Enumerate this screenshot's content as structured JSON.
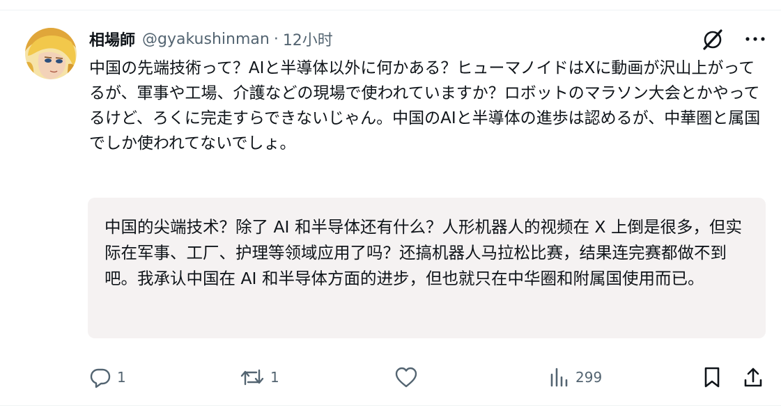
{
  "post": {
    "display_name": "相場師",
    "handle": "@gyakushinman",
    "separator": "·",
    "time": "12小时",
    "text": "中国の先端技術って？AIと半導体以外に何かある？ヒューマノイドはXに動画が沢山上がってるが、軍事や工場、介護などの現場で使われていますか？ロボットのマラソン大会とかやってるけど、ろくに完走すらできないじゃん。中国のAIと半導体の進歩は認めるが、中華圏と属国でしか使われてないでしょ。",
    "translation": "中国的尖端技术？除了 AI 和半导体还有什么？人形机器人的视频在 X 上倒是很多，但实际在军事、工厂、护理等领域应用了吗？还搞机器人马拉松比赛，结果连完赛都做不到吧。我承认中国在 AI 和半导体方面的进步，但也就只在中华圈和附属国使用而已。"
  },
  "actions": {
    "reply_count": "1",
    "repost_count": "1",
    "views_count": "299"
  },
  "icons": {
    "grok": "grok-slash-icon",
    "more": "more-dots-icon",
    "reply": "reply-bubble-icon",
    "repost": "repost-arrows-icon",
    "like": "heart-icon",
    "views": "views-bar-chart-icon",
    "bookmark": "bookmark-icon",
    "share": "share-upload-icon"
  },
  "colors": {
    "text_primary": "#0f1419",
    "text_secondary": "#536471",
    "translation_bg": "#f5f2f2"
  }
}
